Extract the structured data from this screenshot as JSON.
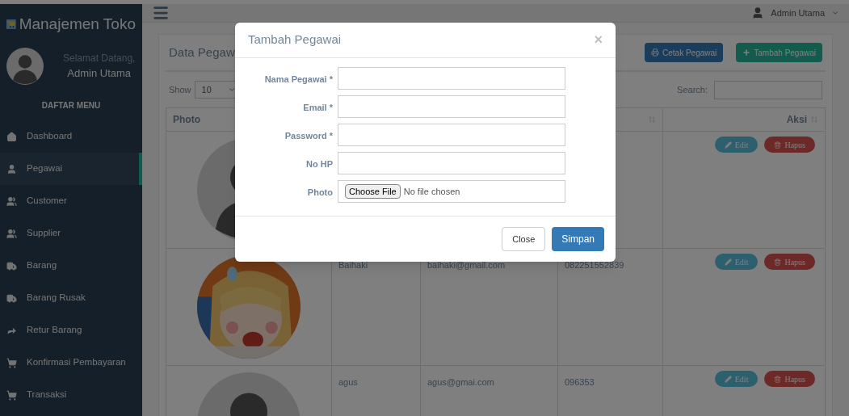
{
  "brand": {
    "title": "Manajemen Toko"
  },
  "profile": {
    "greeting": "Selamat Datang,",
    "name": "Admin Utama"
  },
  "menu_title": "DAFTAR MENU",
  "sidebar": {
    "items": [
      {
        "label": "Dashboard",
        "selected": false
      },
      {
        "label": "Pegawai",
        "selected": true
      },
      {
        "label": "Customer",
        "selected": false
      },
      {
        "label": "Supplier",
        "selected": false
      },
      {
        "label": "Barang",
        "selected": false
      },
      {
        "label": "Barang Rusak",
        "selected": false
      },
      {
        "label": "Retur Barang",
        "selected": false
      },
      {
        "label": "Konfirmasi Pembayaran",
        "selected": false
      },
      {
        "label": "Transaksi",
        "selected": false
      }
    ]
  },
  "topbar": {
    "user": "Admin Utama"
  },
  "panel": {
    "title": "Data Pegaw",
    "print_button": "Cetak Pegawai",
    "add_button": "Tambah Pegawai",
    "show_label": "Show",
    "page_size": "10",
    "search_label": "Search:"
  },
  "table": {
    "columns": [
      "Photo",
      "Aksi"
    ],
    "rows": [
      {
        "kind": "avatar",
        "cells": [],
        "actions": [
          "Edit",
          "Hapus"
        ]
      },
      {
        "kind": "picture",
        "cells": [
          "Baihaki",
          "baihaki@gmail.com",
          "082251552839"
        ],
        "actions": [
          "Edit",
          "Hapus"
        ]
      },
      {
        "kind": "avatar",
        "cells": [
          "agus",
          "agus@gmai.com",
          "096353"
        ],
        "actions": [
          "Edit",
          "Hapus"
        ]
      }
    ]
  },
  "modal": {
    "title": "Tambah Pegawai",
    "close_icon": "×",
    "fields": [
      {
        "label": "Nama Pegawai *",
        "kind": "text"
      },
      {
        "label": "Email *",
        "kind": "text"
      },
      {
        "label": "Password *",
        "kind": "text"
      },
      {
        "label": "No HP",
        "kind": "text"
      },
      {
        "label": "Photo",
        "kind": "file",
        "button": "Choose File",
        "status": "No file chosen"
      }
    ],
    "buttons": [
      "Close",
      "Simpan"
    ]
  }
}
